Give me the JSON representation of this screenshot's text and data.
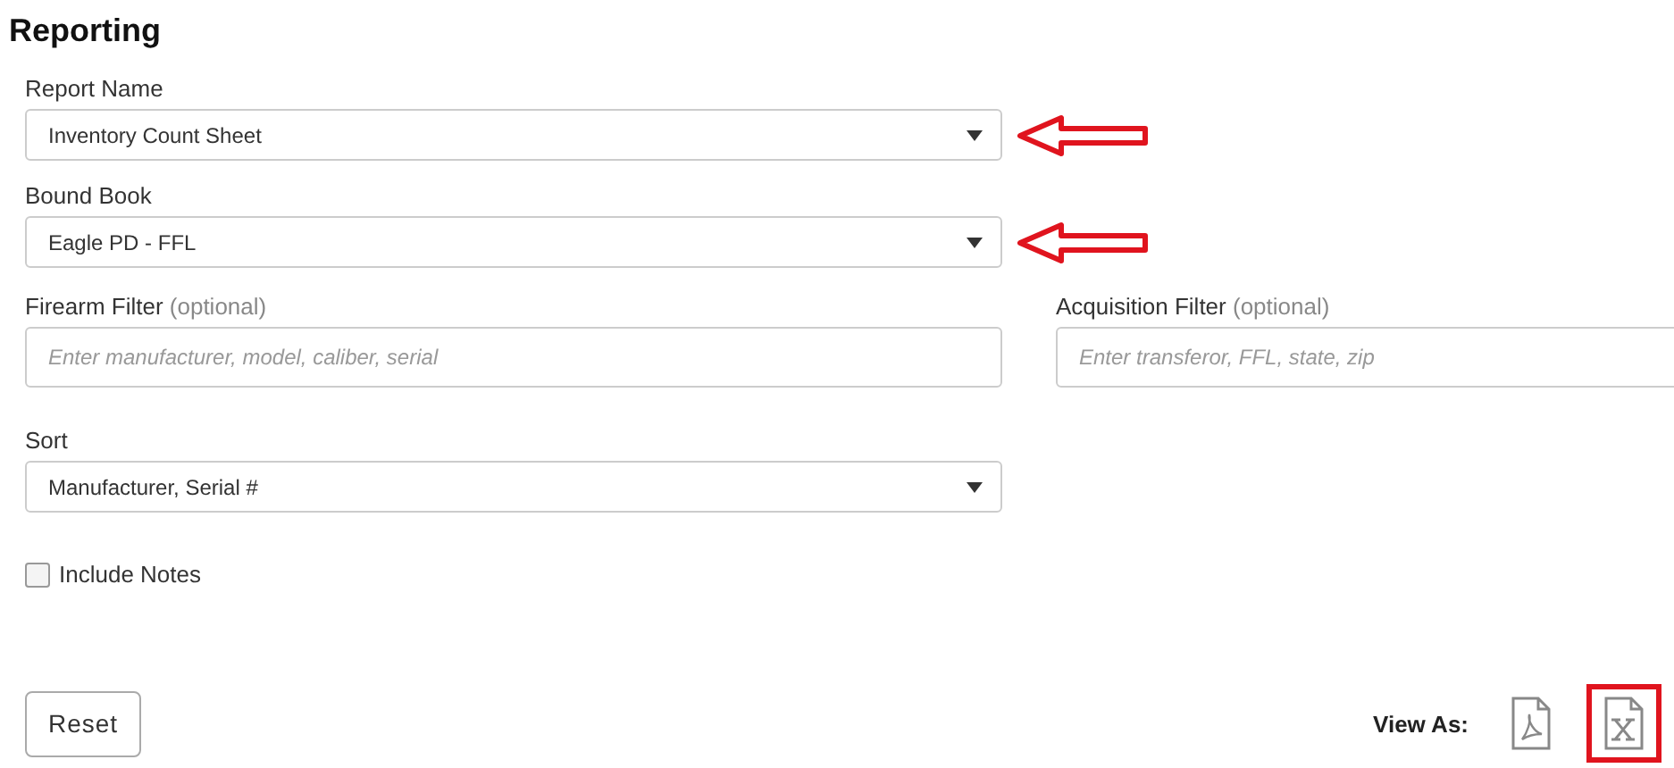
{
  "title": "Reporting",
  "selects": [
    {
      "label": "Report Name",
      "value": "Inventory Count Sheet",
      "annotated": true
    },
    {
      "label": "Bound Book",
      "value": "Eagle PD - FFL",
      "annotated": true
    }
  ],
  "filters": [
    {
      "label": "Firearm Filter",
      "hint": "(optional)",
      "placeholder": "Enter manufacturer, model, caliber, serial"
    },
    {
      "label": "Acquisition Filter",
      "hint": "(optional)",
      "placeholder": "Enter transferor, FFL, state, zip"
    }
  ],
  "sort": {
    "label": "Sort",
    "value": "Manufacturer, Serial #",
    "annotated": false
  },
  "include_notes": {
    "label": "Include Notes",
    "checked": false
  },
  "reset_button": "Reset",
  "view_as": {
    "label": "View As:",
    "formats": [
      {
        "kind": "pdf",
        "highlighted": false
      },
      {
        "kind": "excel",
        "highlighted": true
      }
    ]
  }
}
